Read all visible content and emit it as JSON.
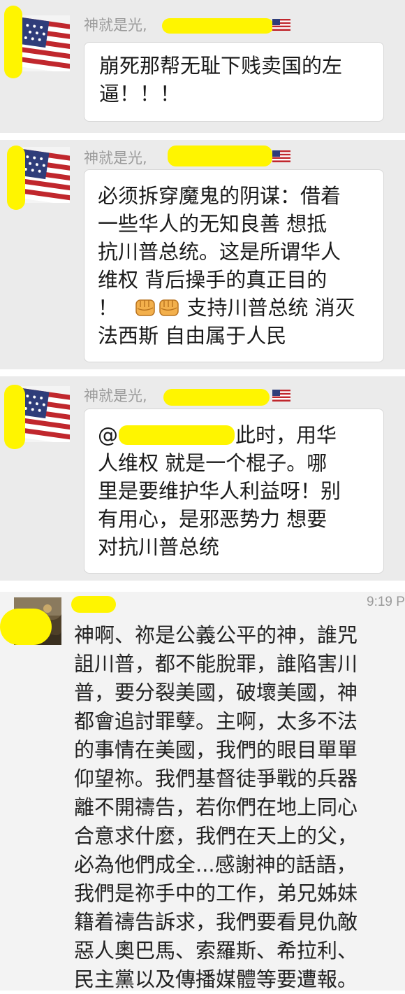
{
  "messages": [
    {
      "sender_name": "神就是光,",
      "text_lines": [
        "崩死那帮无耻下贱卖国的左",
        "逼！！！"
      ]
    },
    {
      "sender_name": "神就是光,",
      "text_lines": [
        "必须拆穿魔鬼的阴谋：借着",
        "一些华人的无知良善 想抵",
        "抗川普总统。这是所谓华人",
        "维权 背后操手的真正目的",
        "！",
        " 支持川普总统 消灭",
        "法西斯 自由属于人民"
      ],
      "emoji": [
        "fist-emoji",
        "fist-emoji"
      ]
    },
    {
      "sender_name": "神就是光,",
      "text_lines": [
        "@",
        "此时，用华",
        "人维权 就是一个棍子。哪",
        "里是要维护华人利益呀！别",
        "有用心，是邪恶势力 想要",
        "对抗川普总统"
      ]
    }
  ],
  "moments_post": {
    "time": "9:19 P",
    "text_lines": [
      "神啊、祢是公義公平的神，誰咒",
      "詛川普，都不能脫罪，誰陷害川",
      "普，要分裂美國，破壞美國，神",
      "都會追討罪孽。主啊，太多不法",
      "的事情在美國，我們的眼目單單",
      "仰望祢。我們基督徒爭戰的兵器",
      "離不開禱告，若你們在地上同心",
      "合意求什麼，我們在天上的父，",
      "必為他們成全...感謝神的話語，",
      "我們是祢手中的工作，弟兄姊妹",
      "籍着禱告訴求，我們要看見仇敵",
      "惡人奧巴馬、索羅斯、希拉利、",
      "民主黨以及傳播媒體等要遭報。"
    ]
  },
  "colors": {
    "panel_bg": "#ebebeb",
    "bubble_bg": "#ffffff",
    "redaction": "#fff500",
    "name_gray": "#9b9b9b"
  },
  "icons": [
    "us-flag-avatar",
    "us-flag-mini-icon",
    "fist-emoji",
    "landscape-avatar"
  ]
}
